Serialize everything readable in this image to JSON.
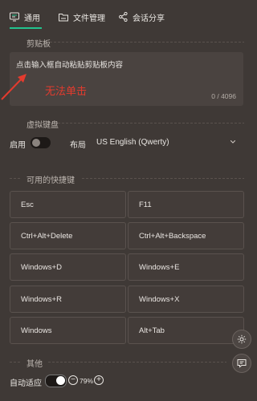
{
  "tabs": [
    {
      "label": "通用",
      "icon": "monitor-icon",
      "active": true
    },
    {
      "label": "文件管理",
      "icon": "folder-icon",
      "active": false
    },
    {
      "label": "会话分享",
      "icon": "share-icon",
      "active": false
    }
  ],
  "accent_color": "#22c38e",
  "clipboard": {
    "section_title": "剪贴板",
    "placeholder": "点击输入框自动粘贴剪贴板内容",
    "counter": "0 / 4096"
  },
  "annotation": {
    "text": "无法单击",
    "color": "#e33b2e"
  },
  "virtual_keyboard": {
    "section_title": "虚拟键盘",
    "enable_label": "启用",
    "enabled": false,
    "layout_label": "布局",
    "layout_value": "US English (Qwerty)"
  },
  "shortcuts": {
    "section_title": "可用的快捷键",
    "keys": [
      "Esc",
      "F11",
      "Ctrl+Alt+Delete",
      "Ctrl+Alt+Backspace",
      "Windows+D",
      "Windows+E",
      "Windows+R",
      "Windows+X",
      "Windows",
      "Alt+Tab"
    ]
  },
  "other": {
    "section_title": "其他",
    "auto_fit_label": "自动适应",
    "auto_fit_enabled": true,
    "zoom": "79%"
  },
  "side_buttons": [
    {
      "icon": "settings-gear-icon"
    },
    {
      "icon": "chat-feedback-icon"
    }
  ]
}
